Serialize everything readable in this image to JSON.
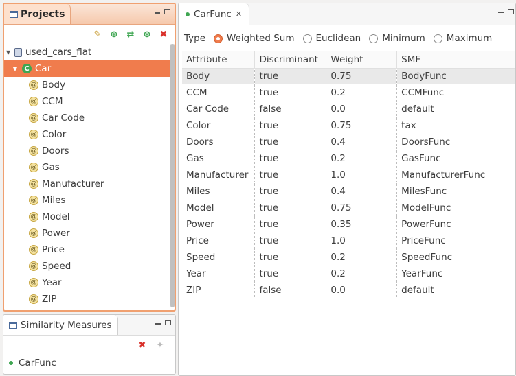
{
  "projects": {
    "title": "Projects",
    "tree": {
      "root": "used_cars_flat",
      "class": "Car",
      "attributes": [
        "Body",
        "CCM",
        "Car Code",
        "Color",
        "Doors",
        "Gas",
        "Manufacturer",
        "Miles",
        "Model",
        "Power",
        "Price",
        "Speed",
        "Year",
        "ZIP"
      ]
    }
  },
  "similarity_measures": {
    "title": "Similarity Measures",
    "items": [
      "CarFunc"
    ]
  },
  "editor": {
    "tab_label": "CarFunc",
    "type_label": "Type",
    "type_options": [
      {
        "label": "Weighted Sum",
        "checked": true
      },
      {
        "label": "Euclidean",
        "checked": false
      },
      {
        "label": "Minimum",
        "checked": false
      },
      {
        "label": "Maximum",
        "checked": false
      }
    ],
    "table": {
      "headers": [
        "Attribute",
        "Discriminant",
        "Weight",
        "SMF"
      ],
      "rows": [
        [
          "Body",
          "true",
          "0.75",
          "BodyFunc"
        ],
        [
          "CCM",
          "true",
          "0.2",
          "CCMFunc"
        ],
        [
          "Car Code",
          "false",
          "0.0",
          "default"
        ],
        [
          "Color",
          "true",
          "0.75",
          "tax"
        ],
        [
          "Doors",
          "true",
          "0.4",
          "DoorsFunc"
        ],
        [
          "Gas",
          "true",
          "0.2",
          "GasFunc"
        ],
        [
          "Manufacturer",
          "true",
          "1.0",
          "ManufacturerFunc"
        ],
        [
          "Miles",
          "true",
          "0.4",
          "MilesFunc"
        ],
        [
          "Model",
          "true",
          "0.75",
          "ModelFunc"
        ],
        [
          "Power",
          "true",
          "0.35",
          "PowerFunc"
        ],
        [
          "Price",
          "true",
          "1.0",
          "PriceFunc"
        ],
        [
          "Speed",
          "true",
          "0.2",
          "SpeedFunc"
        ],
        [
          "Year",
          "true",
          "0.2",
          "YearFunc"
        ],
        [
          "ZIP",
          "false",
          "0.0",
          "default"
        ]
      ]
    }
  }
}
